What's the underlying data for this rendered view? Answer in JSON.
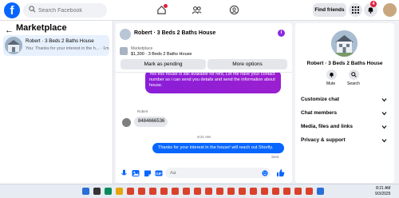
{
  "topbar": {
    "logo": "f",
    "search_placeholder": "Search Facebook",
    "find_friends": "Find friends",
    "notification_count": "4",
    "icons": [
      "home-icon",
      "friends-icon",
      "groups-icon",
      "menu-grid-icon",
      "messenger-icon",
      "bell-icon"
    ]
  },
  "sidebar": {
    "title": "Marketplace",
    "conversation": {
      "name": "Robert · 3 Beds 2 Baths House",
      "snippet": "You: Thanks for your interest in the h... · 1m"
    }
  },
  "chat": {
    "header_title": "Robert · 3 Beds 2 Baths House",
    "listing_label": "Marketplace",
    "listing_desc": "$1,300 · 3 Beds 2 Baths House",
    "mark_pending": "Mark as pending",
    "more_options": "More options",
    "messages": {
      "purple": "Yes this house is still available for rent, Let me have your contact number so i can send you details and send the information about house.",
      "sender_name": "Robert",
      "gray": "8484666536",
      "timestamp": "8:21 AM",
      "blue": "Thanks for your interest in the house! will reach out Shortly.",
      "sent": "Sent"
    },
    "composer_placeholder": "Aa"
  },
  "profile_panel": {
    "name": "Robert · 3 Beds 2 Baths House",
    "mute": "Mute",
    "search": "Search",
    "rows": [
      "Customize chat",
      "Chat members",
      "Media, files and links",
      "Privacy & support"
    ]
  },
  "taskbar": {
    "time": "8:21 AM",
    "date": "9/3/2025"
  },
  "colors": {
    "brand_blue": "#0866ff",
    "purple_bubble": "#8a1ed8",
    "badge_red": "#e41e3f"
  }
}
